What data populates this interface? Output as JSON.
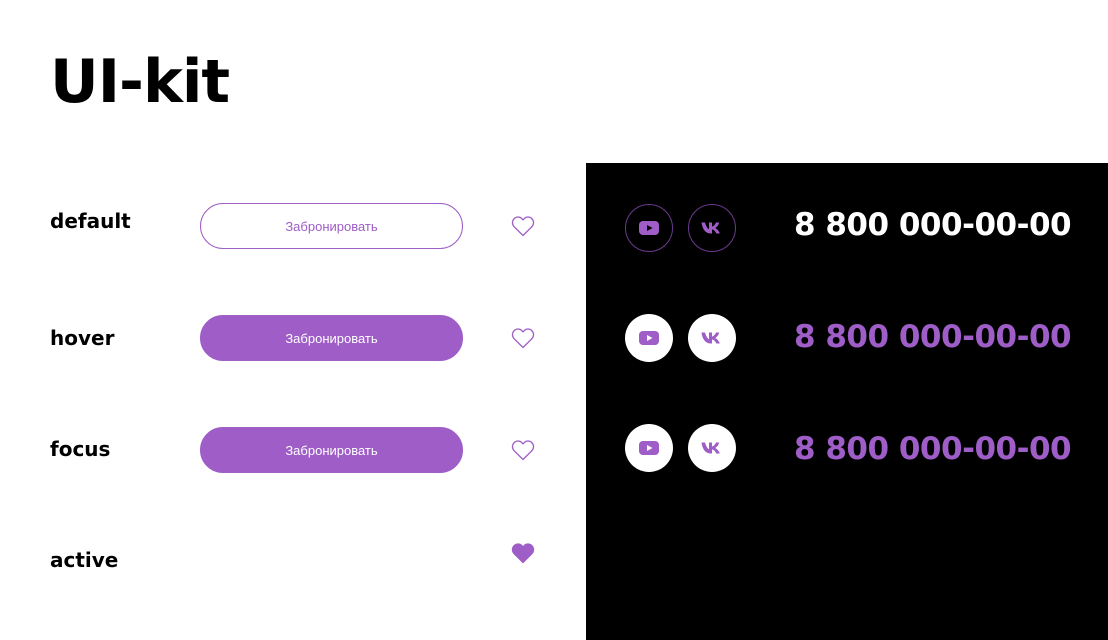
{
  "title": "UI-kit",
  "colors": {
    "accent": "#9e5dc7",
    "panel": "#000000",
    "text": "#000000"
  },
  "states": [
    {
      "label": "default"
    },
    {
      "label": "hover"
    },
    {
      "label": "focus"
    },
    {
      "label": "active"
    }
  ],
  "buttons": [
    {
      "state": "default",
      "label": "Забронировать"
    },
    {
      "state": "hover",
      "label": "Забронировать"
    },
    {
      "state": "focus",
      "label": "Забронировать"
    }
  ],
  "hearts": [
    {
      "state": "default",
      "icon": "heart-outline-icon"
    },
    {
      "state": "hover",
      "icon": "heart-outline-icon"
    },
    {
      "state": "focus",
      "icon": "heart-outline-icon"
    },
    {
      "state": "active",
      "icon": "heart-filled-icon"
    }
  ],
  "dark_panel": {
    "rows": [
      {
        "state": "default",
        "social_icons": [
          "youtube-icon",
          "vk-icon"
        ],
        "phone": "8 800 000-00-00"
      },
      {
        "state": "hover",
        "social_icons": [
          "youtube-icon",
          "vk-icon"
        ],
        "phone": "8 800 000-00-00"
      },
      {
        "state": "focus",
        "social_icons": [
          "youtube-icon",
          "vk-icon"
        ],
        "phone": "8 800 000-00-00"
      }
    ]
  }
}
